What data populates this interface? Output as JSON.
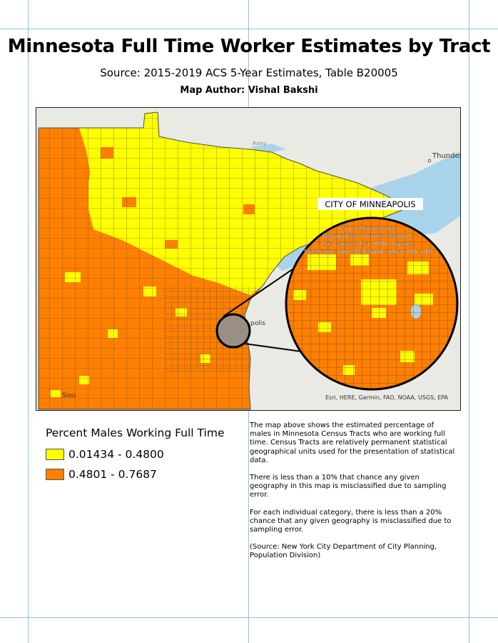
{
  "title": "Minnesota Full Time Worker Estimates by Tract",
  "subtitle": "Source: 2015-2019 ACS 5-Year Estimates, Table B20005",
  "author": "Map Author: Vishal Bakshi",
  "map": {
    "inset_title": "CITY OF MINNEAPOLIS",
    "inset_credits": [
      "City of Minneapolis,",
      "Metropolitan Council, MetroGIS,",
      "Esri Canada, Esri, HERE, Garmin,",
      "SafeGraph, FAO, METI/NASA, USGS, EPA, NPS"
    ],
    "credits": "Esri, HERE, Garmin, FAO, NOAA, USGS, EPA",
    "labels": {
      "thunder_bay": "Thunder B",
      "rainy": "Rainy",
      "minneapolis_partial": "polis",
      "sioux_partial": "Siou"
    },
    "colors": {
      "low": "#ffff00",
      "high": "#ff7f00",
      "basemap": "#e9eae4",
      "water": "#a9d3ea",
      "outline": "#4d4d4d"
    }
  },
  "legend": {
    "title": "Percent Males Working Full Time",
    "items": [
      {
        "label": "0.01434 - 0.4800",
        "color": "#ffff00"
      },
      {
        "label": "0.4801 - 0.7687",
        "color": "#ff7f00"
      }
    ]
  },
  "description": {
    "paragraphs": [
      "The map above shows the estimated percentage of males in Minnesota Census Tracts who are working full time. Census Tracts are relatively permanent statistical geographical units used for the presentation of statistical data.",
      "There is less than a 10% that chance any given geography in this map is misclassified due to sampling error.",
      "For each individual category, there is less than a 20% chance that any given geography is misclassified due to sampling error.",
      "(Source: New York City Department of City Planning, Population Division)"
    ]
  }
}
